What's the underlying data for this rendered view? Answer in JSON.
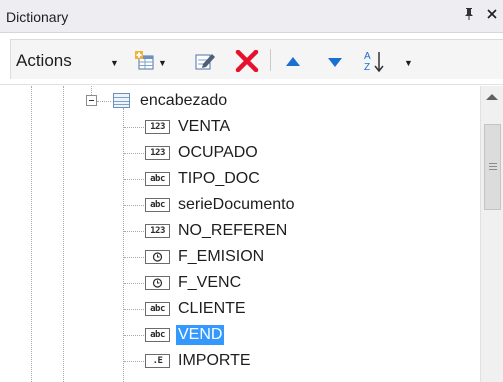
{
  "window": {
    "title": "Dictionary",
    "pin_icon": "pin-icon",
    "close_icon": "close-icon"
  },
  "toolbar": {
    "actions_label": "Actions",
    "buttons": [
      {
        "name": "new-item-button",
        "icon": "add-table-icon"
      },
      {
        "name": "edit-button",
        "icon": "pencil-icon"
      },
      {
        "name": "delete-button",
        "icon": "red-x-icon",
        "color": "#e8112d"
      },
      {
        "name": "move-up-button",
        "icon": "arrow-up-icon",
        "color": "#1a6fd1"
      },
      {
        "name": "move-down-button",
        "icon": "arrow-down-icon",
        "color": "#1a6fd1"
      },
      {
        "name": "sort-button",
        "icon": "sort-az-icon"
      }
    ]
  },
  "tree": {
    "parent": {
      "label": "encabezado",
      "icon": "table-icon",
      "expanded": true
    },
    "fields": [
      {
        "label": "VENTA",
        "type_badge": "123",
        "selected": false
      },
      {
        "label": "OCUPADO",
        "type_badge": "123",
        "selected": false
      },
      {
        "label": "TIPO_DOC",
        "type_badge": "abc",
        "selected": false
      },
      {
        "label": "serieDocumento",
        "type_badge": "abc",
        "selected": false
      },
      {
        "label": "NO_REFEREN",
        "type_badge": "123",
        "selected": false
      },
      {
        "label": "F_EMISION",
        "type_badge": "clock-icon",
        "selected": false
      },
      {
        "label": "F_VENC",
        "type_badge": "clock-icon",
        "selected": false
      },
      {
        "label": "CLIENTE",
        "type_badge": "abc",
        "selected": false
      },
      {
        "label": "VEND",
        "type_badge": "abc",
        "selected": true
      },
      {
        "label": "IMPORTE",
        "type_badge": ".E",
        "selected": false
      }
    ]
  },
  "colors": {
    "selection": "#3399ff",
    "title_bar": "#eeeef2",
    "toolbar": "#f5f5f5"
  }
}
